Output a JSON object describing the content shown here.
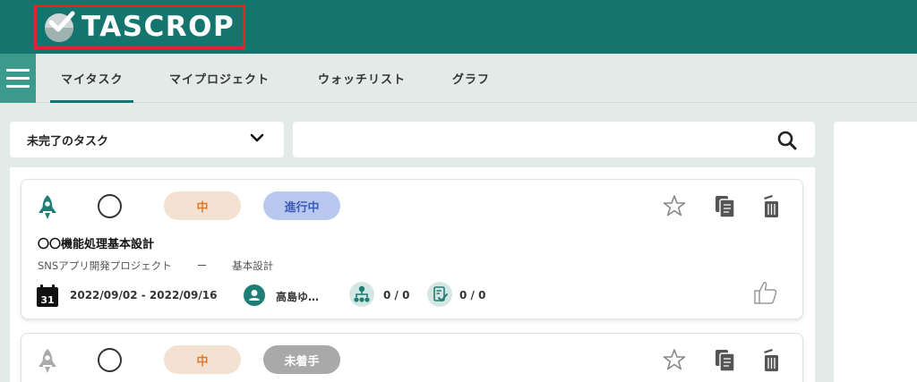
{
  "header": {
    "logo_text": "TASCROP"
  },
  "nav": {
    "tabs": [
      {
        "label": "マイタスク",
        "active": true
      },
      {
        "label": "マイプロジェクト",
        "active": false
      },
      {
        "label": "ウォッチリスト",
        "active": false
      },
      {
        "label": "グラフ",
        "active": false
      }
    ]
  },
  "filter": {
    "selected": "未完了のタスク"
  },
  "search": {
    "value": "",
    "placeholder": ""
  },
  "tasks": [
    {
      "priority": "中",
      "status": "進行中",
      "title": "〇〇機能処理基本設計",
      "project": "SNSアプリ開発プロジェクト",
      "separator": "ー",
      "phase": "基本設計",
      "calendar_day": "31",
      "date_range": "2022/09/02 - 2022/09/16",
      "assignee": "高島ゆ…",
      "subtasks": "0 / 0",
      "checklist": "0 / 0"
    },
    {
      "priority": "中",
      "status": "未着手"
    }
  ],
  "colors": {
    "brand": "#14756f",
    "priority_bg": "#f3e1d2",
    "priority_text": "#e07a2a",
    "status_in_progress_bg": "#b9c8ef",
    "status_not_started_bg": "#a9a9a9"
  }
}
